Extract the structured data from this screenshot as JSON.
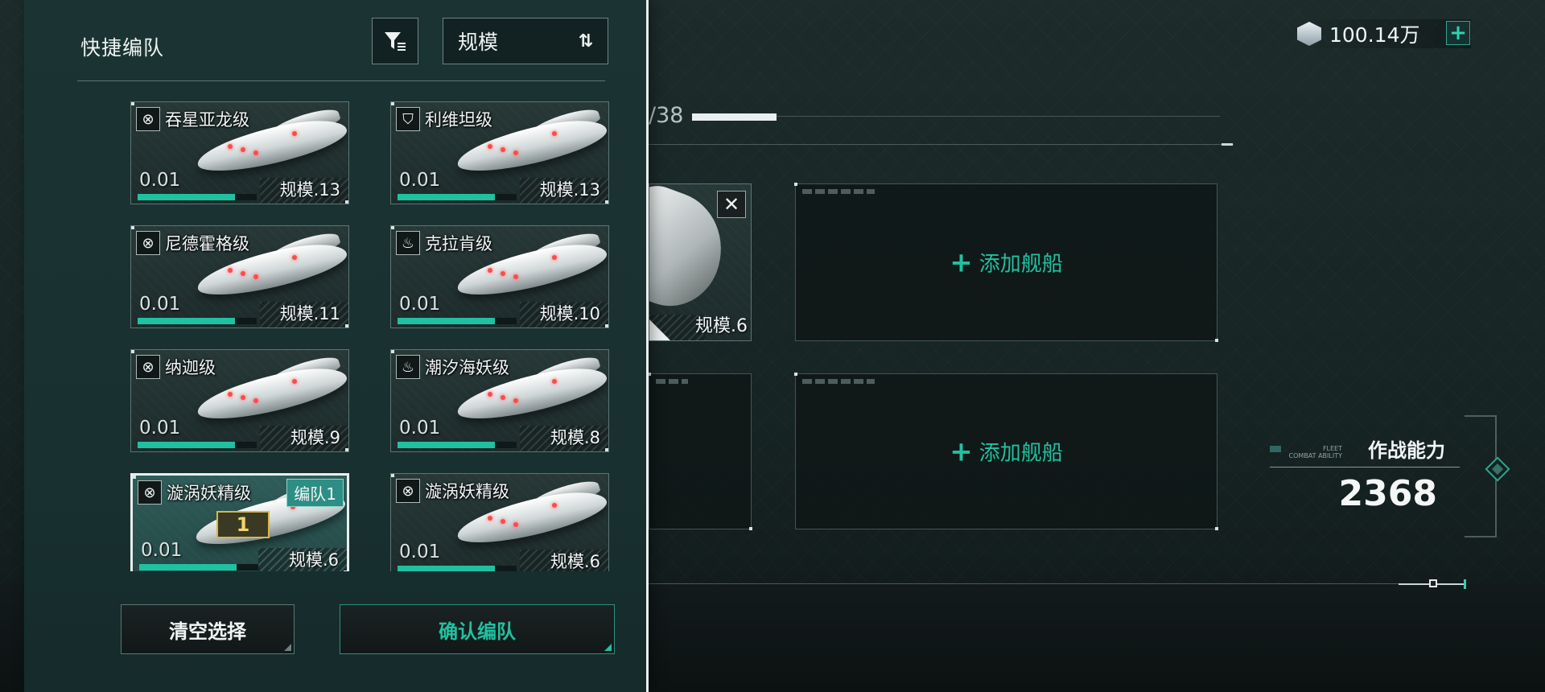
{
  "panel": {
    "title": "快捷编队",
    "sort_label": "规模",
    "ships": [
      {
        "name": "吞星亚龙级",
        "class_icon": "crosshair-icon",
        "level": "0.01",
        "scale": "规模.13",
        "progress": 0.82,
        "selected": false,
        "team": "",
        "order": ""
      },
      {
        "name": "利维坦级",
        "class_icon": "shield-icon",
        "level": "0.01",
        "scale": "规模.13",
        "progress": 0.82,
        "selected": false,
        "team": "",
        "order": ""
      },
      {
        "name": "尼德霍格级",
        "class_icon": "crosshair-icon",
        "level": "0.01",
        "scale": "规模.11",
        "progress": 0.82,
        "selected": false,
        "team": "",
        "order": ""
      },
      {
        "name": "克拉肯级",
        "class_icon": "flame-icon",
        "level": "0.01",
        "scale": "规模.10",
        "progress": 0.82,
        "selected": false,
        "team": "",
        "order": ""
      },
      {
        "name": "纳迦级",
        "class_icon": "crosshair-icon",
        "level": "0.01",
        "scale": "规模.9",
        "progress": 0.82,
        "selected": false,
        "team": "",
        "order": ""
      },
      {
        "name": "潮汐海妖级",
        "class_icon": "flame-icon",
        "level": "0.01",
        "scale": "规模.8",
        "progress": 0.82,
        "selected": false,
        "team": "",
        "order": ""
      },
      {
        "name": "漩涡妖精级",
        "class_icon": "crosshair-icon",
        "level": "0.01",
        "scale": "规模.6",
        "progress": 0.82,
        "selected": true,
        "team": "编队1",
        "order": "1"
      },
      {
        "name": "漩涡妖精级",
        "class_icon": "crosshair-icon",
        "level": "0.01",
        "scale": "规模.6",
        "progress": 0.82,
        "selected": false,
        "team": "",
        "order": ""
      }
    ],
    "clear_button": "清空选择",
    "confirm_button": "确认编队"
  },
  "formation": {
    "resource_value": "100.14万",
    "count_text": "/38",
    "count_fill": 0.16,
    "selected_ship_scale": "规模.6",
    "add_ship_label": "添加舰船"
  },
  "combat": {
    "small_label_1": "FLEET",
    "small_label_2": "COMBAT ABILITY",
    "label": "作战能力",
    "value": "2368"
  },
  "colors": {
    "accent": "#22c0a0",
    "panel_bg": "#1b3433",
    "progress": "#1fc1a1",
    "team_badge": "#2c8e85",
    "order_badge": "#d8b84a"
  }
}
